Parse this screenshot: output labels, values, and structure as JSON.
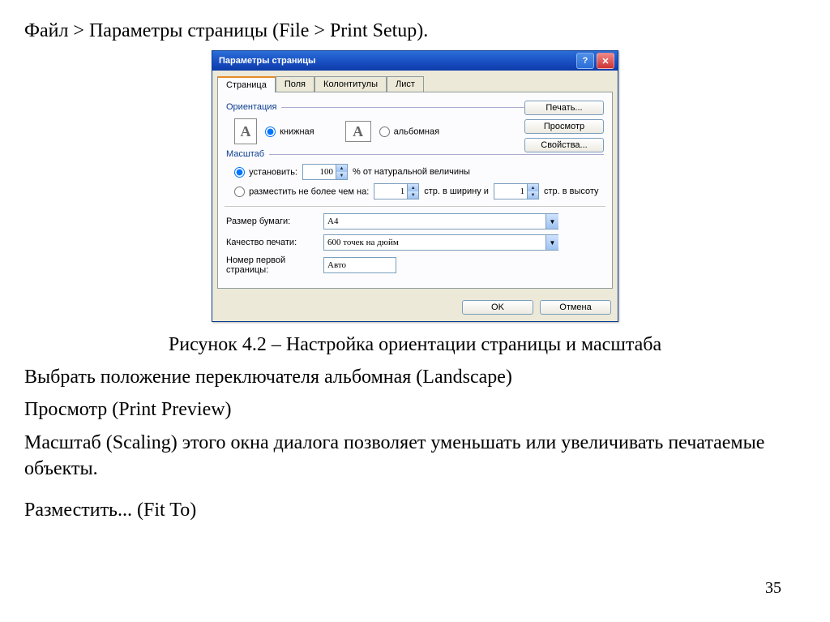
{
  "heading": "Файл > Параметры страницы (File > Print Setup).",
  "caption": "Рисунок 4.2 – Настройка ориентации страницы и масштаба",
  "para1": "Выбрать положение переключателя альбомная (Landscape)",
  "para2": "Просмотр (Print Preview)",
  "para3": "Масштаб (Scaling) этого окна диалога позволяет уменьшать или увеличивать печатаемые объекты.",
  "para4": "Разместить... (Fit To)",
  "page_number": "35",
  "dialog": {
    "title": "Параметры страницы",
    "tabs": [
      "Страница",
      "Поля",
      "Колонтитулы",
      "Лист"
    ],
    "side_buttons": {
      "print": "Печать...",
      "preview": "Просмотр",
      "options": "Свойства..."
    },
    "orientation": {
      "group": "Ориентация",
      "portrait": "книжная",
      "landscape": "альбомная"
    },
    "scale": {
      "group": "Масштаб",
      "set_label": "установить:",
      "percent_value": "100",
      "percent_suffix": "% от натуральной величины",
      "fit_label": "разместить не более чем на:",
      "fit_w": "1",
      "fit_mid": "стр. в ширину и",
      "fit_h": "1",
      "fit_suffix": "стр. в высоту"
    },
    "paper_size_label": "Размер бумаги:",
    "paper_size_value": "A4",
    "quality_label": "Качество печати:",
    "quality_value": "600 точек на дюйм",
    "first_page_label": "Номер первой страницы:",
    "first_page_value": "Авто",
    "ok": "OK",
    "cancel": "Отмена"
  }
}
